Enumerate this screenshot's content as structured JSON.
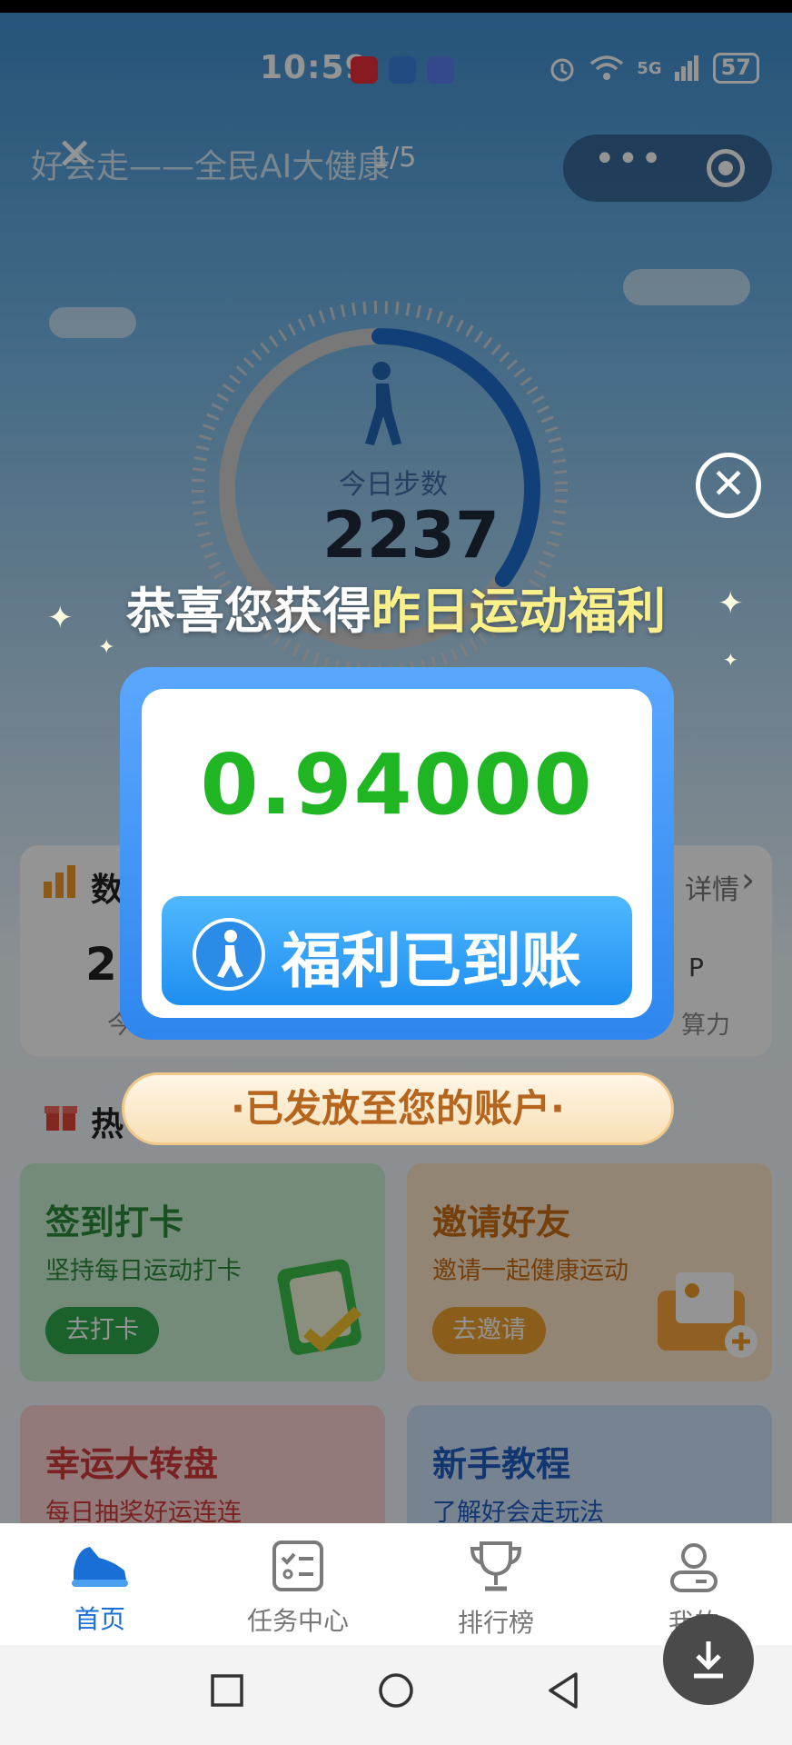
{
  "status_bar": {
    "time": "10:59",
    "network": "5G",
    "battery": "57"
  },
  "mini_program": {
    "title": "好会走——全民AI大健康",
    "page_indicator": "1/5"
  },
  "gauge": {
    "label": "今日步数",
    "steps": "2237",
    "progress_fraction": 0.35
  },
  "data_card": {
    "title_partial": "数",
    "detail_partial": "详情",
    "value_partial": "2",
    "unit_partial": "P",
    "sub_left_partial": "今",
    "sub_right_partial": "算力"
  },
  "hot_section": {
    "title_partial": "热"
  },
  "tiles": [
    {
      "title": "签到打卡",
      "subtitle": "坚持每日运动打卡",
      "button": "去打卡",
      "color": "#2a8a3a",
      "bg": "#c9efd0",
      "btn_bg": "#2ea84a"
    },
    {
      "title": "邀请好友",
      "subtitle": "邀请一起健康运动",
      "button": "去邀请",
      "color": "#c86d12",
      "bg": "#fde5c8",
      "btn_bg": "#f0a030"
    },
    {
      "title": "幸运大转盘",
      "subtitle": "每日抽奖好运连连",
      "color": "#d33a3a",
      "bg": "#fbd3d3"
    },
    {
      "title": "新手教程",
      "subtitle": "了解好会走玩法",
      "color": "#1f5fc2",
      "bg": "#cfe2fa"
    }
  ],
  "modal": {
    "headline_plain": "恭喜您获得",
    "headline_highlight": "昨日运动福利",
    "amount": "0.94000",
    "button_label": "福利已到账",
    "issued_label": "·已发放至您的账户·"
  },
  "tabbar": [
    {
      "label": "首页",
      "icon": "sneaker-icon",
      "active": true
    },
    {
      "label": "任务中心",
      "icon": "checklist-icon",
      "active": false
    },
    {
      "label": "排行榜",
      "icon": "trophy-icon",
      "active": false
    },
    {
      "label": "我的",
      "icon": "profile-icon",
      "active": false
    }
  ]
}
